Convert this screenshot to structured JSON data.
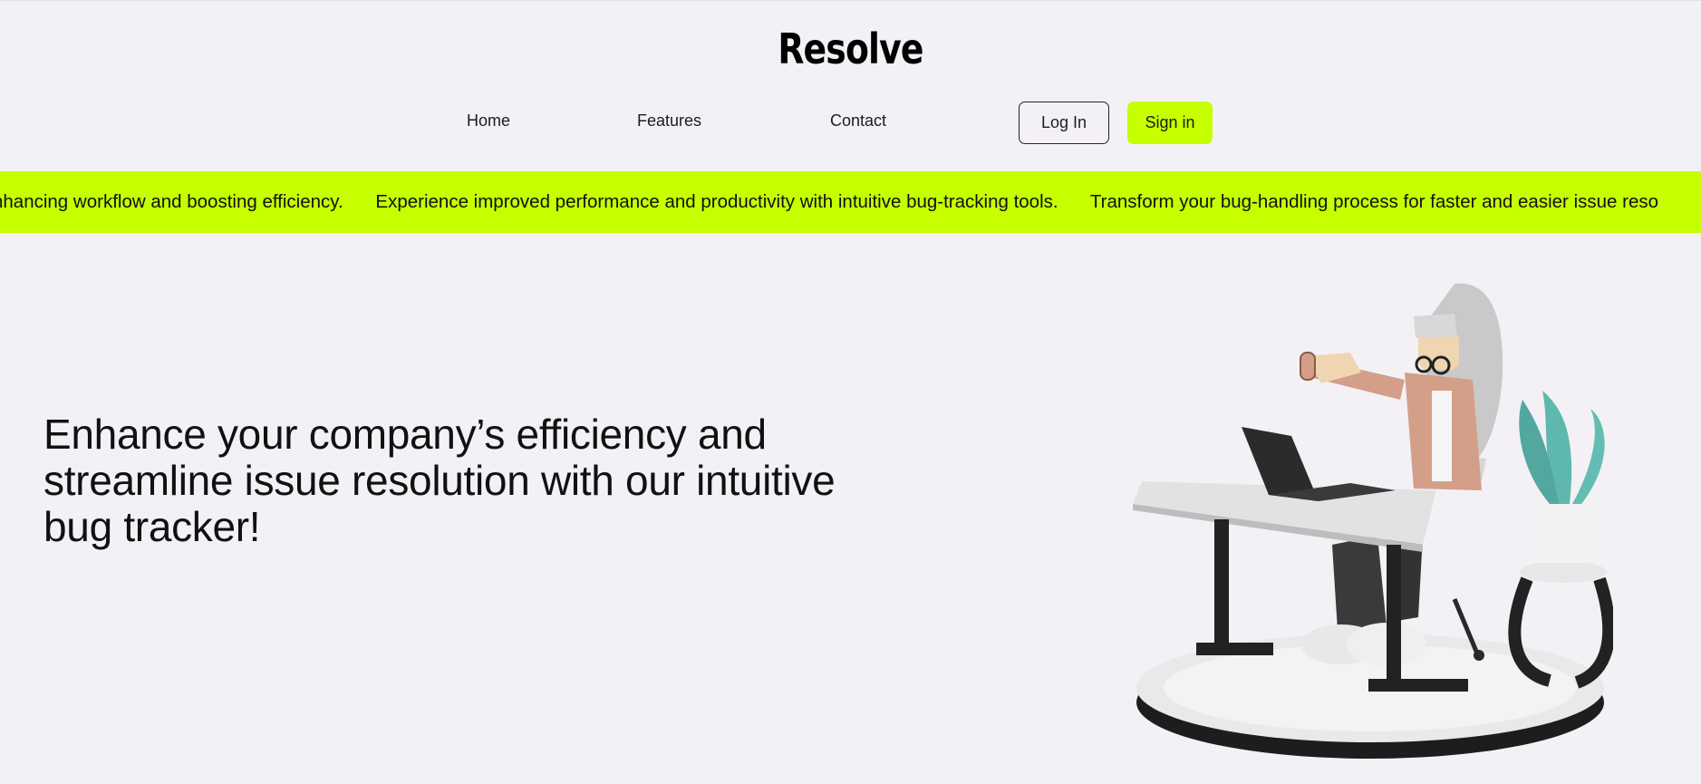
{
  "brand": {
    "logo": "Resolve"
  },
  "nav": {
    "links": [
      "Home",
      "Features",
      "Contact"
    ],
    "login_label": "Log In",
    "signin_label": "Sign in"
  },
  "marquee": {
    "items": [
      "nhancing workflow and boosting efficiency.",
      "Experience improved performance and productivity with intuitive bug-tracking tools.",
      "Transform your bug-handling process for faster and easier issue reso"
    ]
  },
  "hero": {
    "headline": "Enhance your company’s efficiency and streamline issue resolution with our intuitive bug tracker!"
  },
  "colors": {
    "accent": "#c5ff00",
    "background": "#f4f1f6",
    "text": "#111111"
  },
  "icons": {
    "illustration": "person-at-desk-illustration"
  }
}
